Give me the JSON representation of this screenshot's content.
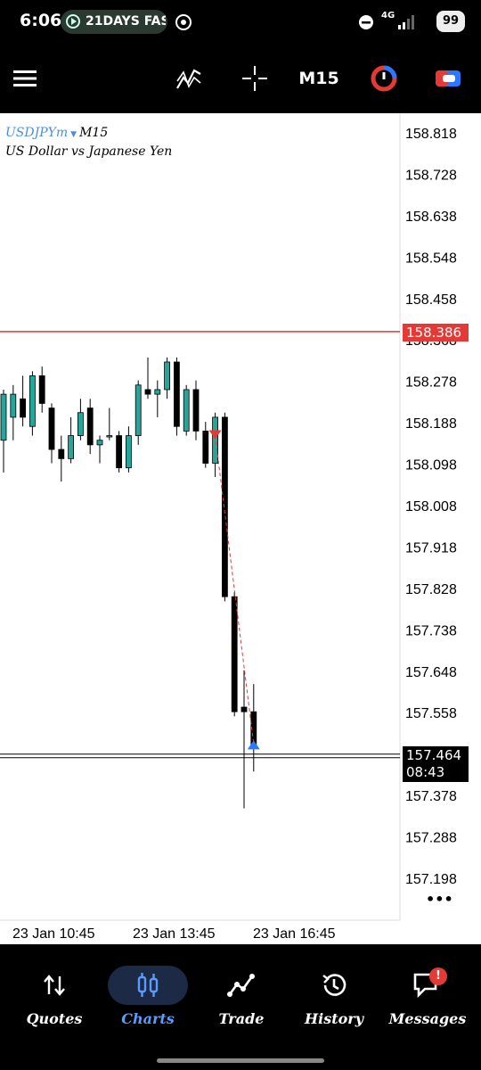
{
  "status_bar": {
    "time": "6:06",
    "notification": "21DAYS FAS",
    "network": "4G",
    "battery": "99"
  },
  "toolbar": {
    "timeframe": "M15",
    "menu_icon": "hamburger-icon",
    "indicator_icon": "indicator-icon",
    "crosshair_icon": "crosshair-icon",
    "one_click_icon": "one-click-trading-icon",
    "new_order_icon": "new-order-icon"
  },
  "chart": {
    "symbol": "USDJPYm",
    "timeframe": "M15",
    "description": "US Dollar vs Japanese Yen",
    "bid_line_price": "158.386",
    "current_price": "157.464",
    "countdown": "08:43",
    "more_label": "•••"
  },
  "chart_data": {
    "type": "candlestick",
    "title": "USDJPYm M15",
    "y_ticks": [
      "158.818",
      "158.728",
      "158.638",
      "158.548",
      "158.458",
      "158.368",
      "158.278",
      "158.188",
      "158.098",
      "158.008",
      "157.918",
      "157.828",
      "157.738",
      "157.648",
      "157.558",
      "157.378",
      "157.288",
      "157.198"
    ],
    "x_ticks": [
      "23 Jan 10:45",
      "23 Jan 13:45",
      "23 Jan 16:45"
    ],
    "ylim": [
      157.15,
      158.86
    ],
    "ask_line": 158.386,
    "bid_line": 157.464,
    "candles": [
      {
        "o": 158.15,
        "h": 158.26,
        "l": 158.08,
        "c": 158.25
      },
      {
        "o": 158.2,
        "h": 158.27,
        "l": 158.15,
        "c": 158.25
      },
      {
        "o": 158.24,
        "h": 158.29,
        "l": 158.18,
        "c": 158.2
      },
      {
        "o": 158.18,
        "h": 158.3,
        "l": 158.16,
        "c": 158.29
      },
      {
        "o": 158.29,
        "h": 158.31,
        "l": 158.21,
        "c": 158.23
      },
      {
        "o": 158.22,
        "h": 158.23,
        "l": 158.1,
        "c": 158.13
      },
      {
        "o": 158.13,
        "h": 158.16,
        "l": 158.06,
        "c": 158.11
      },
      {
        "o": 158.11,
        "h": 158.2,
        "l": 158.1,
        "c": 158.16
      },
      {
        "o": 158.16,
        "h": 158.24,
        "l": 158.15,
        "c": 158.21
      },
      {
        "o": 158.22,
        "h": 158.24,
        "l": 158.12,
        "c": 158.14
      },
      {
        "o": 158.14,
        "h": 158.16,
        "l": 158.1,
        "c": 158.15
      },
      {
        "o": 158.16,
        "h": 158.22,
        "l": 158.15,
        "c": 158.16
      },
      {
        "o": 158.16,
        "h": 158.17,
        "l": 158.08,
        "c": 158.09
      },
      {
        "o": 158.09,
        "h": 158.18,
        "l": 158.08,
        "c": 158.16
      },
      {
        "o": 158.16,
        "h": 158.28,
        "l": 158.14,
        "c": 158.27
      },
      {
        "o": 158.26,
        "h": 158.33,
        "l": 158.24,
        "c": 158.25
      },
      {
        "o": 158.25,
        "h": 158.28,
        "l": 158.2,
        "c": 158.26
      },
      {
        "o": 158.26,
        "h": 158.33,
        "l": 158.24,
        "c": 158.32
      },
      {
        "o": 158.32,
        "h": 158.33,
        "l": 158.16,
        "c": 158.18
      },
      {
        "o": 158.17,
        "h": 158.27,
        "l": 158.16,
        "c": 158.26
      },
      {
        "o": 158.26,
        "h": 158.28,
        "l": 158.15,
        "c": 158.17
      },
      {
        "o": 158.17,
        "h": 158.19,
        "l": 158.09,
        "c": 158.1
      },
      {
        "o": 158.1,
        "h": 158.21,
        "l": 158.07,
        "c": 158.2
      },
      {
        "o": 158.2,
        "h": 158.21,
        "l": 157.8,
        "c": 157.81
      },
      {
        "o": 157.81,
        "h": 157.82,
        "l": 157.55,
        "c": 157.56
      },
      {
        "o": 157.57,
        "h": 157.65,
        "l": 157.35,
        "c": 157.56
      },
      {
        "o": 157.56,
        "h": 157.62,
        "l": 157.43,
        "c": 157.48
      }
    ],
    "trade_markers": [
      {
        "type": "sell",
        "candle": 22,
        "price": 158.16
      },
      {
        "type": "buy",
        "candle": 26,
        "price": 157.49
      }
    ]
  },
  "bottom_nav": {
    "items": [
      {
        "label": "Quotes",
        "icon": "quotes-icon"
      },
      {
        "label": "Charts",
        "icon": "charts-icon",
        "active": true
      },
      {
        "label": "Trade",
        "icon": "trade-icon"
      },
      {
        "label": "History",
        "icon": "history-icon"
      },
      {
        "label": "Messages",
        "icon": "messages-icon",
        "badge": "!"
      }
    ]
  },
  "colors": {
    "bull": "#26a69a",
    "bear": "#000000",
    "ask_line": "#e53935",
    "accent": "#4a90e2"
  }
}
